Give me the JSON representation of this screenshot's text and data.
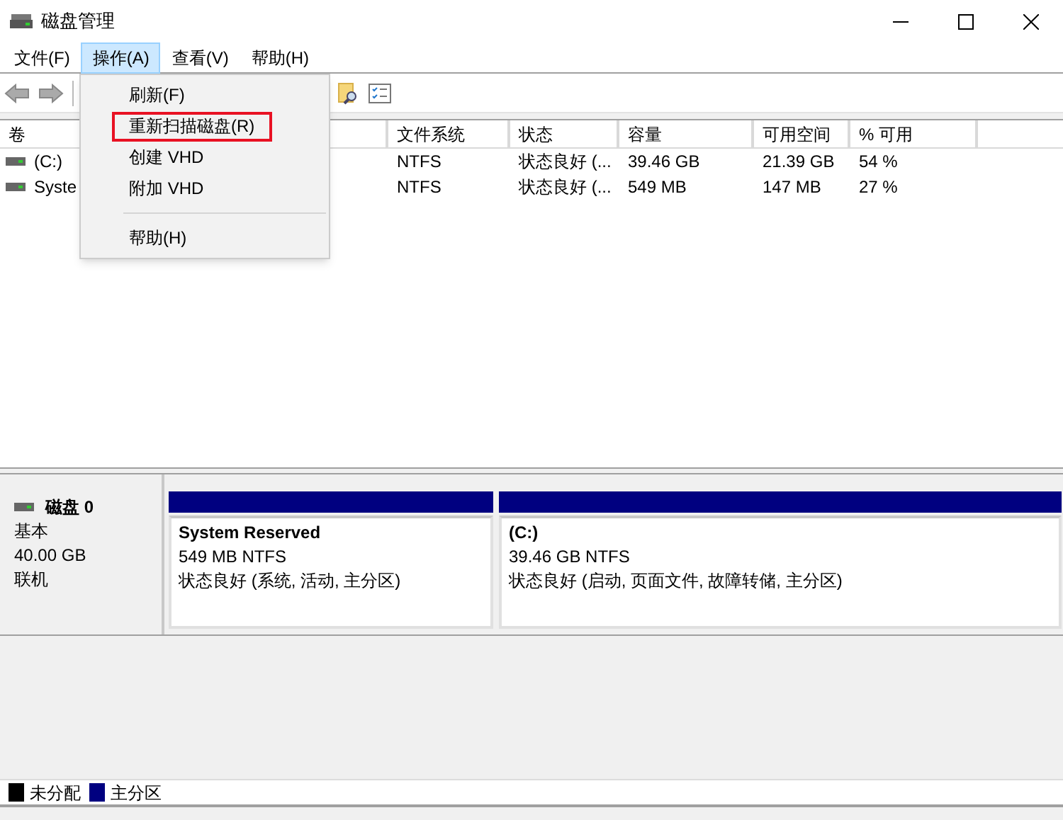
{
  "window": {
    "title": "磁盘管理"
  },
  "menu_bar": [
    {
      "label": "文件(F)",
      "selected": false
    },
    {
      "label": "操作(A)",
      "selected": true
    },
    {
      "label": "查看(V)",
      "selected": false
    },
    {
      "label": "帮助(H)",
      "selected": false
    }
  ],
  "dropdown": [
    {
      "label": "刷新(F)",
      "highlighted": false
    },
    {
      "label": "重新扫描磁盘(R)",
      "highlighted": true
    },
    {
      "label": "创建 VHD",
      "highlighted": false
    },
    {
      "label": "附加 VHD",
      "highlighted": false
    },
    {
      "kind": "separator"
    },
    {
      "label": "帮助(H)",
      "highlighted": false
    }
  ],
  "table": {
    "columns": [
      "卷",
      "文件系统",
      "状态",
      "容量",
      "可用空间",
      "% 可用"
    ],
    "rows": [
      [
        "(C:)",
        "NTFS",
        "状态良好 (...",
        "39.46 GB",
        "21.39 GB",
        "54 %"
      ],
      [
        "Syste",
        "NTFS",
        "状态良好 (...",
        "549 MB",
        "147 MB",
        "27 %"
      ]
    ]
  },
  "disk": {
    "name": "磁盘 0",
    "type": "基本",
    "size": "40.00 GB",
    "status": "联机",
    "partitions": [
      {
        "name": "System Reserved",
        "size": "549 MB NTFS",
        "status": "状态良好 (系统, 活动, 主分区)",
        "color": "#000080"
      },
      {
        "name": "(C:)",
        "size": "39.46 GB NTFS",
        "status": "状态良好 (启动, 页面文件, 故障转储, 主分区)",
        "color": "#000080"
      }
    ]
  },
  "legend": [
    {
      "label": "未分配",
      "color": "#000000"
    },
    {
      "label": "主分区",
      "color": "#000080"
    }
  ]
}
